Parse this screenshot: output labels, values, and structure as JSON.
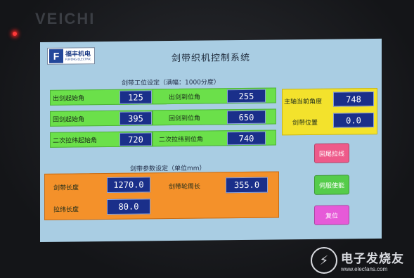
{
  "device": {
    "brand": "VEICHI",
    "power_led_color": "#ff3a3a"
  },
  "logo": {
    "mark": "F",
    "cn": "福丰机电",
    "en": "FUFENG ELECTRIC"
  },
  "screen": {
    "title": "剑带织机控制系统",
    "background": "#a9cde3"
  },
  "position_settings": {
    "title": "剑带工位设定（满幅：1000分度）",
    "rows": [
      {
        "left_label": "出剑起始角",
        "left_value": "125",
        "right_label": "出剑到位角",
        "right_value": "255"
      },
      {
        "left_label": "回剑起始角",
        "left_value": "395",
        "right_label": "回剑到位角",
        "right_value": "650"
      },
      {
        "left_label": "二次拉纬起始角",
        "left_value": "720",
        "right_label": "二次拉纬到位角",
        "right_value": "740"
      }
    ]
  },
  "status": {
    "spindle_angle_label": "主轴当前角度",
    "spindle_angle_value": "748",
    "rapier_pos_label": "剑带位置",
    "rapier_pos_value": "0.0"
  },
  "parameter_settings": {
    "title": "剑带参数设定（单位mm）",
    "rapier_length_label": "剑带长度",
    "rapier_length_value": "1270.0",
    "wheel_circ_label": "剑带轮周长",
    "wheel_circ_value": "355.0",
    "weft_length_label": "拉纬长度",
    "weft_length_value": "80.0"
  },
  "buttons": {
    "tail_pull": "回尾拉线",
    "servo_enable": "伺服使能",
    "reset": "复位"
  },
  "watermark": {
    "cn": "电子发烧友",
    "url": "www.elecfans.com"
  },
  "colors": {
    "green_panel": "#6be04a",
    "yellow_panel": "#f3e22c",
    "orange_panel": "#f4912a",
    "value_box": "#1a2f8a"
  }
}
